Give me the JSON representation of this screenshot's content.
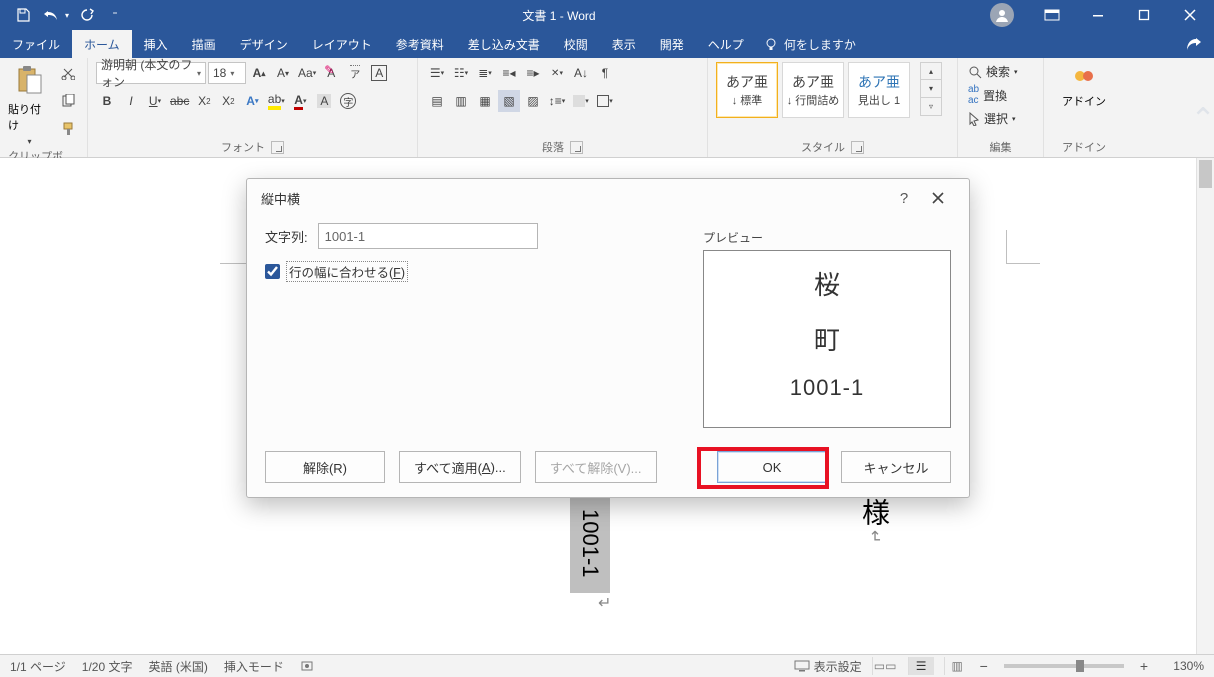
{
  "app": {
    "title": "文書 1 - Word"
  },
  "tabs": {
    "items": [
      "ファイル",
      "ホーム",
      "挿入",
      "描画",
      "デザイン",
      "レイアウト",
      "参考資料",
      "差し込み文書",
      "校閲",
      "表示",
      "開発",
      "ヘルプ"
    ],
    "active_index": 1,
    "tell_me_prompt": "何をしますか"
  },
  "ribbon": {
    "clipboard": {
      "label": "クリップボード",
      "paste": "貼り付け"
    },
    "font": {
      "label": "フォント",
      "family": "游明朝 (本文のフォン",
      "size": "18",
      "bold": "B",
      "italic": "I",
      "underline": "U",
      "strike": "abc",
      "sub": "X₂",
      "sup": "X²",
      "case": "Aa",
      "clear": "A",
      "border": "A",
      "hl": "ab",
      "color": "A",
      "ruby": "ル",
      "enc": "A",
      "grow": "A",
      "shrink": "A"
    },
    "paragraph": {
      "label": "段落"
    },
    "styles": {
      "label": "スタイル",
      "items": [
        {
          "sample": "あア亜",
          "name": "↓ 標準"
        },
        {
          "sample": "あア亜",
          "name": "↓ 行間詰め"
        },
        {
          "sample": "あア亜",
          "name": "見出し 1"
        }
      ]
    },
    "editing": {
      "label": "編集",
      "find": "検索",
      "replace": "置換",
      "select": "選択"
    },
    "addins": {
      "label": "アドイン",
      "button": "アドイン"
    }
  },
  "dialog": {
    "title": "縦中横",
    "string_label": "文字列:",
    "string_value": "1001-1",
    "fit_label": "行の幅に合わせる(F)",
    "fit_accel": "F",
    "fit_checked": true,
    "preview_label": "プレビュー",
    "preview_lines": [
      "桜",
      "町",
      "1001-1"
    ],
    "buttons": {
      "remove": "解除(R)",
      "apply_all": "すべて適用(A)...",
      "remove_all": "すべて解除(V)...",
      "ok": "OK",
      "cancel": "キャンセル"
    }
  },
  "document": {
    "vertical_text": "様",
    "selected_text": "1001-1"
  },
  "status": {
    "page": "1/1 ページ",
    "words": "1/20 文字",
    "language": "英語 (米国)",
    "mode": "挿入モード",
    "display_settings": "表示設定",
    "zoom": "130%"
  }
}
